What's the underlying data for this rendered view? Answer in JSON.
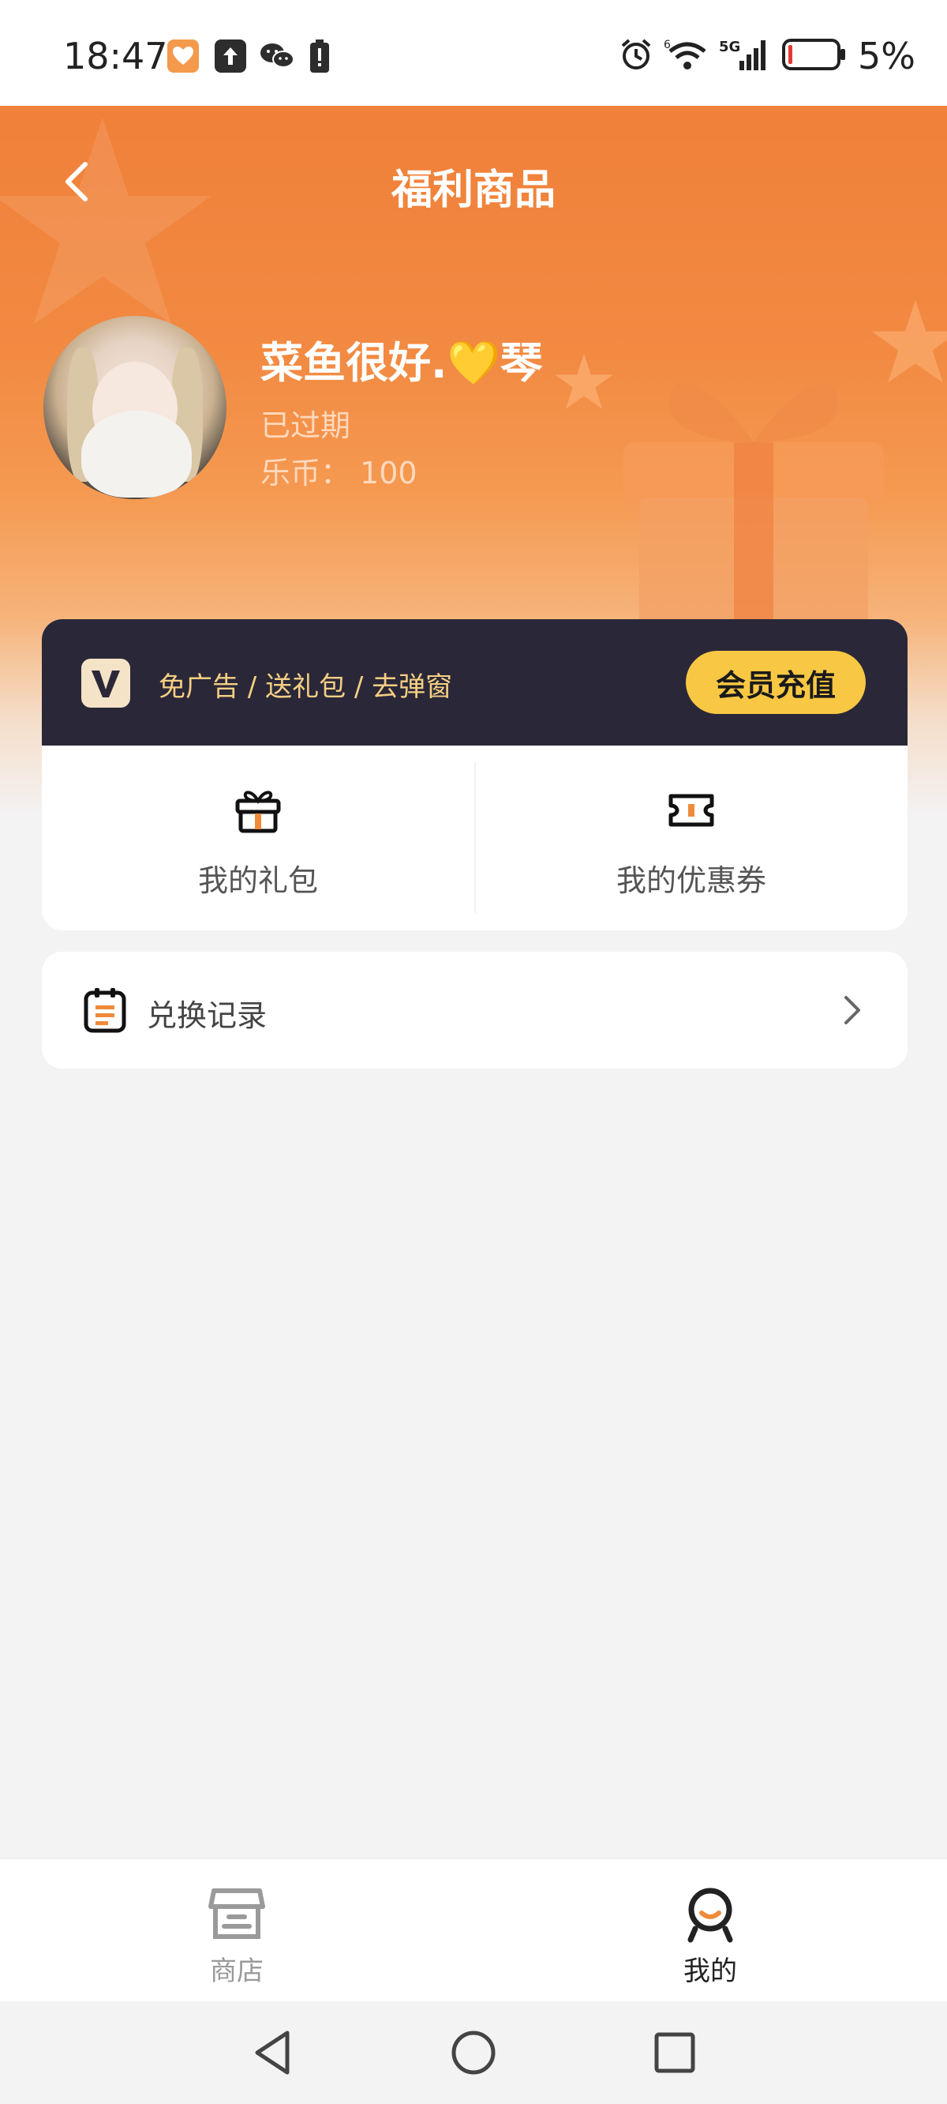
{
  "status_bar": {
    "time": "18:47",
    "battery_percent": "5%",
    "network": "5G",
    "icons": [
      "health-app-icon",
      "upload-icon",
      "wechat-icon",
      "battery-alert-icon",
      "alarm-icon",
      "wifi-icon",
      "signal-icon",
      "battery-icon"
    ]
  },
  "header": {
    "title": "福利商品",
    "back_icon": "chevron-left-icon"
  },
  "profile": {
    "username": "菜鱼很好.💛琴",
    "membership_status": "已过期",
    "coins_label": "乐币：",
    "coins_value": "100",
    "coins_text": "乐币： 100"
  },
  "vip": {
    "logo_letter": "V",
    "benefits": "免广告 / 送礼包 / 去弹窗",
    "recharge_button": "会员充值"
  },
  "quick_actions": [
    {
      "label": "我的礼包",
      "icon": "gift-icon"
    },
    {
      "label": "我的优惠券",
      "icon": "ticket-icon"
    }
  ],
  "exchange_record": {
    "label": "兑换记录",
    "icon": "clipboard-icon"
  },
  "tab_bar": [
    {
      "label": "商店",
      "icon": "store-icon",
      "active": false
    },
    {
      "label": "我的",
      "icon": "profile-icon",
      "active": true
    }
  ],
  "colors": {
    "accent": "#f0803a",
    "vip_bar": "#2a2838",
    "vip_text": "#f6cf84",
    "recharge_button": "#f8c844",
    "tab_active": "#222222",
    "tab_inactive": "#9a9a9a"
  },
  "nav_bar": {
    "icons": [
      "back-triangle-icon",
      "home-circle-icon",
      "recents-square-icon"
    ]
  }
}
